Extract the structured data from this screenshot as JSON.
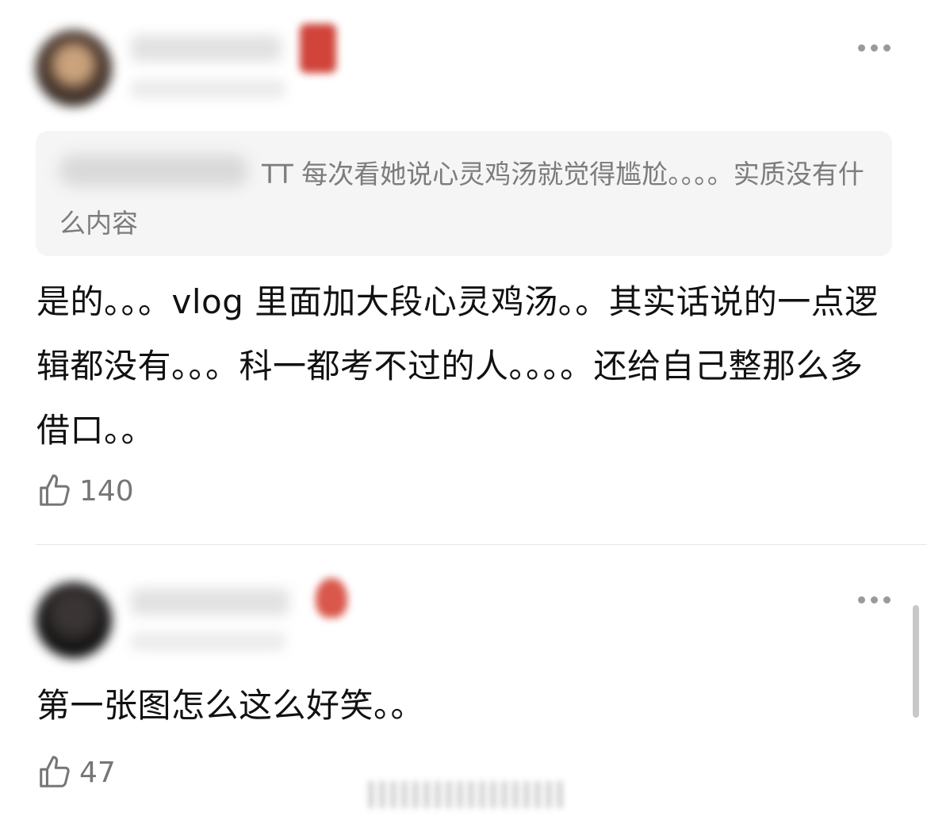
{
  "comments": [
    {
      "quote": {
        "text": "TT 每次看她说心灵鸡汤就觉得尴尬。。。。实质没有什么内容"
      },
      "text": "是的。。。vlog 里面加大段心灵鸡汤。。其实话说的一点逻辑都没有。。。科一都考不过的人。。。。还给自己整那么多借口。。",
      "likes": "140"
    },
    {
      "text": "第一张图怎么这么好笑。。",
      "likes": "47"
    }
  ],
  "icons": {
    "like": "thumbs-up-icon",
    "more": "more-dots-icon"
  },
  "colors": {
    "background": "#ffffff",
    "quote_background": "#f5f5f5",
    "secondary_text": "#767676",
    "badge_red": "#c9332a"
  }
}
